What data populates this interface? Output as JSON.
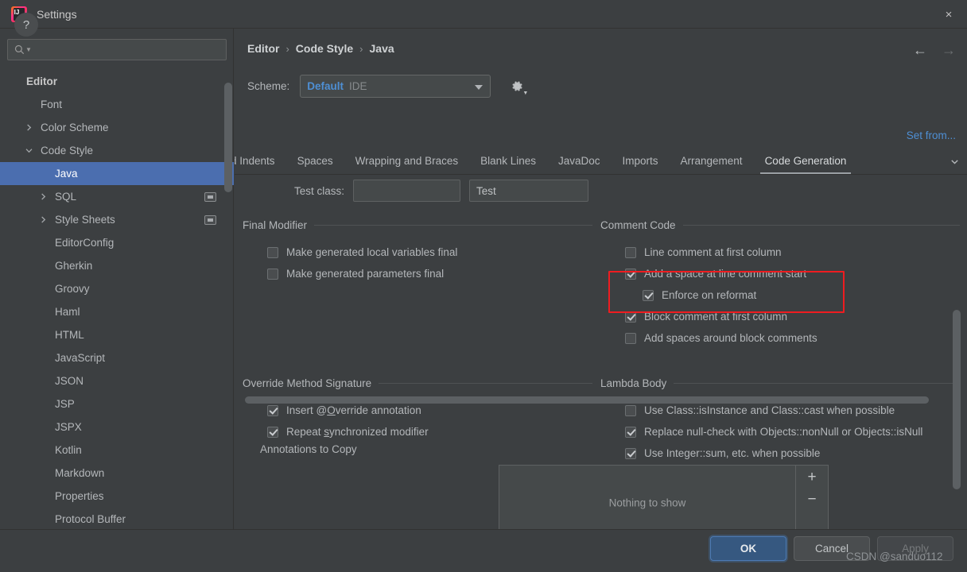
{
  "window": {
    "title": "Settings",
    "logo_text": "IJ",
    "close_icon": "×"
  },
  "search": {
    "value": "",
    "placeholder": ""
  },
  "sidebar": {
    "items": [
      {
        "label": "Editor",
        "indent": 0,
        "twisty": "none",
        "bold": true,
        "selected": false,
        "badge": false
      },
      {
        "label": "Font",
        "indent": 1,
        "twisty": "none",
        "bold": false,
        "selected": false,
        "badge": false
      },
      {
        "label": "Color Scheme",
        "indent": 1,
        "twisty": "collapsed",
        "bold": false,
        "selected": false,
        "badge": false
      },
      {
        "label": "Code Style",
        "indent": 1,
        "twisty": "expanded",
        "bold": false,
        "selected": false,
        "badge": false
      },
      {
        "label": "Java",
        "indent": 2,
        "twisty": "none",
        "bold": false,
        "selected": true,
        "badge": false
      },
      {
        "label": "SQL",
        "indent": 2,
        "twisty": "collapsed",
        "bold": false,
        "selected": false,
        "badge": true
      },
      {
        "label": "Style Sheets",
        "indent": 2,
        "twisty": "collapsed",
        "bold": false,
        "selected": false,
        "badge": true
      },
      {
        "label": "EditorConfig",
        "indent": 2,
        "twisty": "none",
        "bold": false,
        "selected": false,
        "badge": false
      },
      {
        "label": "Gherkin",
        "indent": 2,
        "twisty": "none",
        "bold": false,
        "selected": false,
        "badge": false
      },
      {
        "label": "Groovy",
        "indent": 2,
        "twisty": "none",
        "bold": false,
        "selected": false,
        "badge": false
      },
      {
        "label": "Haml",
        "indent": 2,
        "twisty": "none",
        "bold": false,
        "selected": false,
        "badge": false
      },
      {
        "label": "HTML",
        "indent": 2,
        "twisty": "none",
        "bold": false,
        "selected": false,
        "badge": false
      },
      {
        "label": "JavaScript",
        "indent": 2,
        "twisty": "none",
        "bold": false,
        "selected": false,
        "badge": false
      },
      {
        "label": "JSON",
        "indent": 2,
        "twisty": "none",
        "bold": false,
        "selected": false,
        "badge": false
      },
      {
        "label": "JSP",
        "indent": 2,
        "twisty": "none",
        "bold": false,
        "selected": false,
        "badge": false
      },
      {
        "label": "JSPX",
        "indent": 2,
        "twisty": "none",
        "bold": false,
        "selected": false,
        "badge": false
      },
      {
        "label": "Kotlin",
        "indent": 2,
        "twisty": "none",
        "bold": false,
        "selected": false,
        "badge": false
      },
      {
        "label": "Markdown",
        "indent": 2,
        "twisty": "none",
        "bold": false,
        "selected": false,
        "badge": false
      },
      {
        "label": "Properties",
        "indent": 2,
        "twisty": "none",
        "bold": false,
        "selected": false,
        "badge": false
      },
      {
        "label": "Protocol Buffer",
        "indent": 2,
        "twisty": "none",
        "bold": false,
        "selected": false,
        "badge": false
      }
    ]
  },
  "header": {
    "breadcrumb": [
      "Editor",
      "Code Style",
      "Java"
    ],
    "breadcrumb_separator": "›",
    "back_arrow": "←",
    "forward_arrow": "→",
    "scheme_label": "Scheme:",
    "scheme_value": "Default",
    "scheme_scope": "IDE",
    "gear_icon": "gear-icon",
    "set_from_link": "Set from..."
  },
  "tabs": {
    "items": [
      {
        "label": "and Indents",
        "active": false,
        "clipped": true
      },
      {
        "label": "Spaces",
        "active": false,
        "clipped": false
      },
      {
        "label": "Wrapping and Braces",
        "active": false,
        "clipped": false
      },
      {
        "label": "Blank Lines",
        "active": false,
        "clipped": false
      },
      {
        "label": "JavaDoc",
        "active": false,
        "clipped": false
      },
      {
        "label": "Imports",
        "active": false,
        "clipped": false
      },
      {
        "label": "Arrangement",
        "active": false,
        "clipped": false
      },
      {
        "label": "Code Generation",
        "active": true,
        "clipped": false
      }
    ],
    "overflow_icon": "chevron-down-icon"
  },
  "settings": {
    "test_class": {
      "label": "Test class:",
      "prefix_value": "",
      "suffix_value": "Test"
    },
    "final_modifier": {
      "title": "Final Modifier",
      "options": [
        {
          "label": "Make generated local variables final",
          "checked": false,
          "indent": 0
        },
        {
          "label": "Make generated parameters final",
          "checked": false,
          "indent": 0
        }
      ]
    },
    "comment_code": {
      "title": "Comment Code",
      "options": [
        {
          "label": "Line comment at first column",
          "checked": false,
          "indent": 0,
          "highlighted": false
        },
        {
          "label": "Add a space at line comment start",
          "checked": true,
          "indent": 0,
          "highlighted": true
        },
        {
          "label": "Enforce on reformat",
          "checked": true,
          "indent": 1,
          "highlighted": true
        },
        {
          "label": "Block comment at first column",
          "checked": true,
          "indent": 0,
          "highlighted": false
        },
        {
          "label": "Add spaces around block comments",
          "checked": false,
          "indent": 0,
          "highlighted": false
        }
      ],
      "highlight_color": "#ef1c20"
    },
    "override_method_signature": {
      "title": "Override Method Signature",
      "options": [
        {
          "label": "Insert @Override annotation",
          "checked": true,
          "indent": 0,
          "mnemonic": "O"
        },
        {
          "label": "Repeat synchronized modifier",
          "checked": true,
          "indent": 0,
          "mnemonic": "s"
        }
      ],
      "annotations_label": "Annotations to Copy",
      "annotations_empty": "Nothing to show",
      "add_button": "+",
      "remove_button": "−"
    },
    "lambda_body": {
      "title": "Lambda Body",
      "options": [
        {
          "label": "Use Class::isInstance and Class::cast when possible",
          "checked": false,
          "indent": 0
        },
        {
          "label": "Replace null-check with Objects::nonNull or Objects::isNull",
          "checked": true,
          "indent": 0
        },
        {
          "label": "Use Integer::sum, etc. when possible",
          "checked": true,
          "indent": 0
        }
      ]
    }
  },
  "footer": {
    "help_icon": "?",
    "ok": "OK",
    "cancel": "Cancel",
    "apply": "Apply"
  },
  "watermark": "CSDN @sanduo112",
  "colors": {
    "background": "#3c3f41",
    "selection": "#4b6eaf",
    "link": "#4e8fd4",
    "accent_button": "#365880",
    "annotation_red": "#ef1c20"
  }
}
